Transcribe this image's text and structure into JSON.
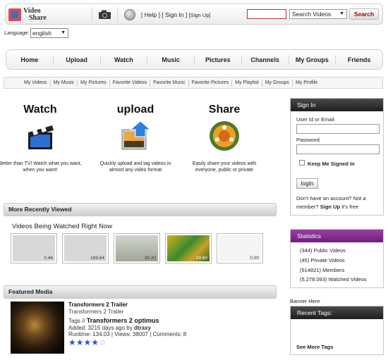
{
  "header": {
    "logo_line1": "Video",
    "logo_line2": "Share",
    "links_left_bracket": "[ ",
    "help": "Help",
    "sep": " ] [ ",
    "sign_in": "Sign In",
    "sep2": " ] ",
    "sign_up": "[Sign Up]",
    "search_value": "",
    "search_select": "Search Videos",
    "search_button": "Search"
  },
  "language": {
    "label": "Language:",
    "value": "english"
  },
  "main_nav": [
    "Home",
    "Upload",
    "Watch",
    "Music",
    "Pictures",
    "Channels",
    "My Groups",
    "Friends"
  ],
  "sub_nav": [
    "My Videos",
    "My Music",
    "My Pictures",
    "Favorite Videos",
    "Favorite Music",
    "Favorite Pictures",
    "My Playlist",
    "My Groups",
    "My Profile"
  ],
  "features": [
    {
      "title": "Watch",
      "text": "Better than TV! Watch what you want, when you want!",
      "icon": "clapperboard-icon"
    },
    {
      "title": "upload",
      "text": "Quickly upload and tag videos in almost any video format",
      "icon": "upload-photo-icon"
    },
    {
      "title": "Share",
      "text": "Easily share your videos with everyone, public or private",
      "icon": "share-globe-icon"
    }
  ],
  "recently_viewed": {
    "bar_title": "More Recently Viewed",
    "subtitle": "Videos Being Watched Right Now",
    "thumbs": [
      "0.46",
      "169.64",
      "30.20",
      "29.60",
      "0.00"
    ]
  },
  "featured": {
    "bar_title": "Featured Media",
    "title": "Transformers 2 Trailer",
    "subtitle": "Transformers 2 Trailer",
    "tags_label": "Tags // ",
    "tags": "Transformers  2  optimus",
    "added": "Added: 3215 days ago by ",
    "user": "dtraxy",
    "meta": "Runtime: 134.03 | Views: 38007 | Comments: 8",
    "rating": 4
  },
  "signin": {
    "title": "Sign In",
    "user_label": "User Id or Email",
    "password_label": "Password",
    "keep_label": "Keep Me Signed In",
    "login_button": "login",
    "no_account": "Don't have an account? Not a member? ",
    "signup_link": "Sign Up",
    "free": " it's free"
  },
  "statistics": {
    "title": "Statistics",
    "lines": [
      "(344) Public Videos",
      "(45) Private Videos",
      "(514821) Members",
      "(5.278.093) Watched Videos"
    ]
  },
  "banner": "Banner Here",
  "recent_tags": {
    "title": "Recent Tags:",
    "more": "See More Tags"
  }
}
